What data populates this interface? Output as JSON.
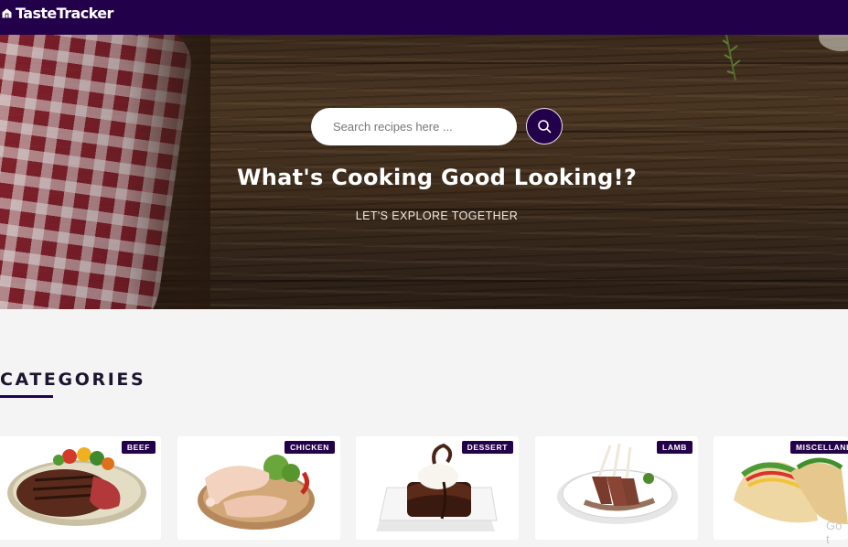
{
  "brand": {
    "name": "TasteTracker",
    "icon": "home-icon"
  },
  "hero": {
    "search_placeholder": "Search recipes here ...",
    "search_icon": "search-icon",
    "title": "What's Cooking Good Looking!?",
    "subtitle": "LET'S EXPLORE TOGETHER"
  },
  "categories": {
    "heading": "CATEGORIES",
    "items": [
      {
        "label": "BEEF"
      },
      {
        "label": "CHICKEN"
      },
      {
        "label": "DESSERT"
      },
      {
        "label": "LAMB"
      },
      {
        "label": "MISCELLANE"
      }
    ]
  },
  "overlay_text": "Go t",
  "colors": {
    "nav": "#23004a",
    "accent": "#23004a",
    "background": "#f4f4f4"
  }
}
